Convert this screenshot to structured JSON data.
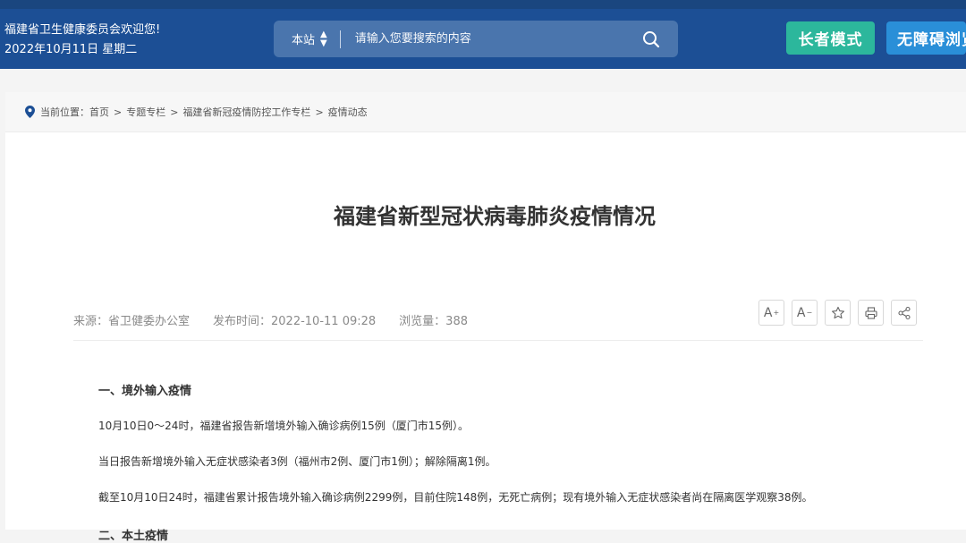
{
  "header": {
    "welcome": "福建省卫生健康委员会欢迎您!",
    "date": "2022年10月11日 星期二",
    "search_scope": "本站",
    "search_placeholder": "请输入您要搜索的内容",
    "elder_mode": "长者模式",
    "accessibility_mode": "无障碍浏览"
  },
  "breadcrumb": {
    "prefix": "当前位置：",
    "items": [
      "首页",
      "专题专栏",
      "福建省新冠疫情防控工作专栏",
      "疫情动态"
    ],
    "separator": ">"
  },
  "article": {
    "title": "福建省新型冠状病毒肺炎疫情情况",
    "source": "来源：省卫健委办公室",
    "publish_time": "发布时间：2022-10-11 09:28",
    "views": "浏览量：388",
    "tools": {
      "font_increase": "A",
      "font_decrease": "A"
    },
    "section1_heading": "一、境外输入疫情",
    "paragraphs": [
      "10月10日0～24时，福建省报告新增境外输入确诊病例15例（厦门市15例）。",
      "当日报告新增境外输入无症状感染者3例（福州市2例、厦门市1例）；解除隔离1例。",
      "截至10月10日24时，福建省累计报告境外输入确诊病例2299例，目前住院148例，无死亡病例；现有境外输入无症状感染者尚在隔离医学观察38例。"
    ],
    "section2_heading_partial": "二、本土疫情"
  },
  "colors": {
    "header_bg": "#1c4f95",
    "elder_btn": "#2cb79c",
    "access_btn": "#2a8fd8"
  }
}
